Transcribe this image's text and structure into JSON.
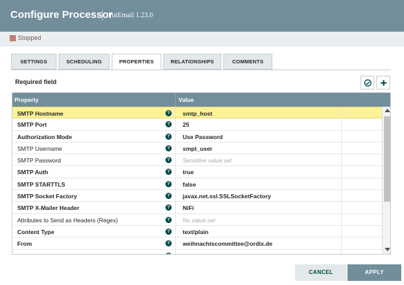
{
  "dialog": {
    "title": "Configure Processor",
    "subtitle": "PutEmail 1.23.0"
  },
  "status": {
    "label": "Stopped",
    "color": "#ba554a"
  },
  "tabs": [
    {
      "label": "SETTINGS",
      "active": false
    },
    {
      "label": "SCHEDULING",
      "active": false
    },
    {
      "label": "PROPERTIES",
      "active": true
    },
    {
      "label": "RELATIONSHIPS",
      "active": false
    },
    {
      "label": "COMMENTS",
      "active": false
    }
  ],
  "properties_panel": {
    "required_label": "Required field",
    "verify_icon": "check-circle-icon",
    "add_icon": "plus-icon",
    "columns": {
      "property": "Property",
      "value": "Value"
    },
    "rows": [
      {
        "name": "SMTP Hostname",
        "value": "smtp_host",
        "required": true,
        "placeholder": false,
        "selected": true
      },
      {
        "name": "SMTP Port",
        "value": "25",
        "required": true,
        "placeholder": false,
        "selected": false
      },
      {
        "name": "Authorization Mode",
        "value": "Use Password",
        "required": true,
        "placeholder": false,
        "selected": false
      },
      {
        "name": "SMTP Username",
        "value": "smpt_user",
        "required": false,
        "placeholder": false,
        "selected": false
      },
      {
        "name": "SMTP Password",
        "value": "Sensitive value set",
        "required": false,
        "placeholder": true,
        "selected": false
      },
      {
        "name": "SMTP Auth",
        "value": "true",
        "required": true,
        "placeholder": false,
        "selected": false
      },
      {
        "name": "SMTP STARTTLS",
        "value": "false",
        "required": true,
        "placeholder": false,
        "selected": false
      },
      {
        "name": "SMTP Socket Factory",
        "value": "javax.net.ssl.SSLSocketFactory",
        "required": true,
        "placeholder": false,
        "selected": false
      },
      {
        "name": "SMTP X-Mailer Header",
        "value": "NiFi",
        "required": true,
        "placeholder": false,
        "selected": false
      },
      {
        "name": "Attributes to Send as Headers (Regex)",
        "value": "No value set",
        "required": false,
        "placeholder": true,
        "selected": false
      },
      {
        "name": "Content Type",
        "value": "text/plain",
        "required": true,
        "placeholder": false,
        "selected": false
      },
      {
        "name": "From",
        "value": "weihnachtscommittee@ordix.de",
        "required": true,
        "placeholder": false,
        "selected": false
      },
      {
        "name": "To",
        "value": "${email_to}",
        "required": false,
        "placeholder": false,
        "selected": false
      }
    ]
  },
  "footer": {
    "cancel_label": "CANCEL",
    "apply_label": "APPLY"
  }
}
